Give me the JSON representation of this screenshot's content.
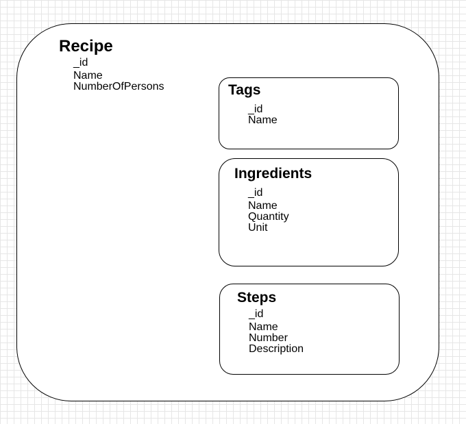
{
  "recipe": {
    "title": "Recipe",
    "fields": [
      "_id",
      "Name",
      "NumberOfPersons"
    ]
  },
  "tags": {
    "title": "Tags",
    "fields": [
      "_id",
      "Name"
    ]
  },
  "ingredients": {
    "title": "Ingredients",
    "fields": [
      "_id",
      "Name",
      "Quantity",
      "Unit"
    ]
  },
  "steps": {
    "title": "Steps",
    "fields": [
      "_id",
      "Name",
      "Number",
      "Description"
    ]
  }
}
